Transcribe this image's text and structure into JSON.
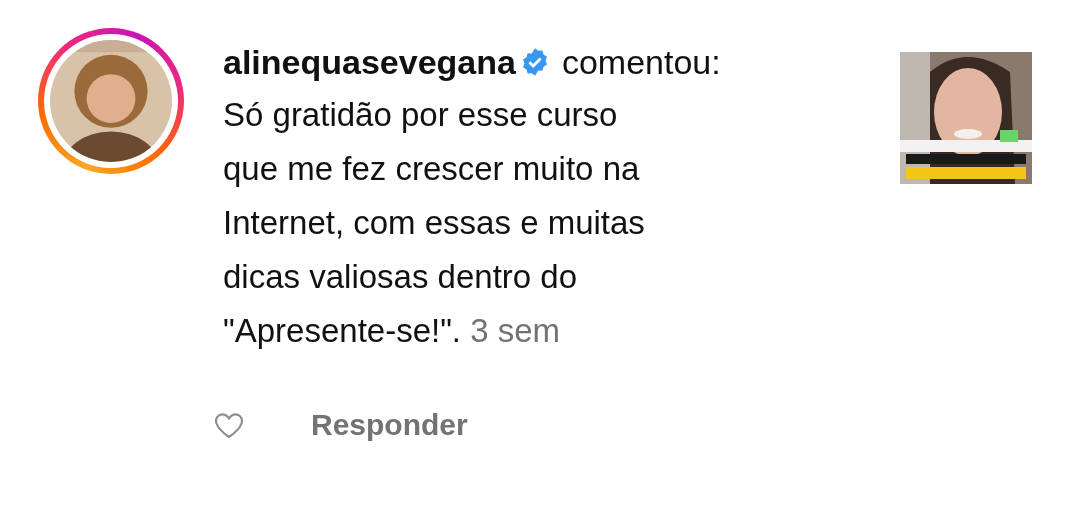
{
  "comment": {
    "username": "alinequasevegana",
    "verified": true,
    "action": "comentou:",
    "text": "Só gratidão por esse curso que me fez crescer muito na Internet, com essas e muitas dicas valiosas dentro do \"Apresente-se!\".",
    "time": "3 sem"
  },
  "actions": {
    "liked": false,
    "reply": "Responder"
  }
}
